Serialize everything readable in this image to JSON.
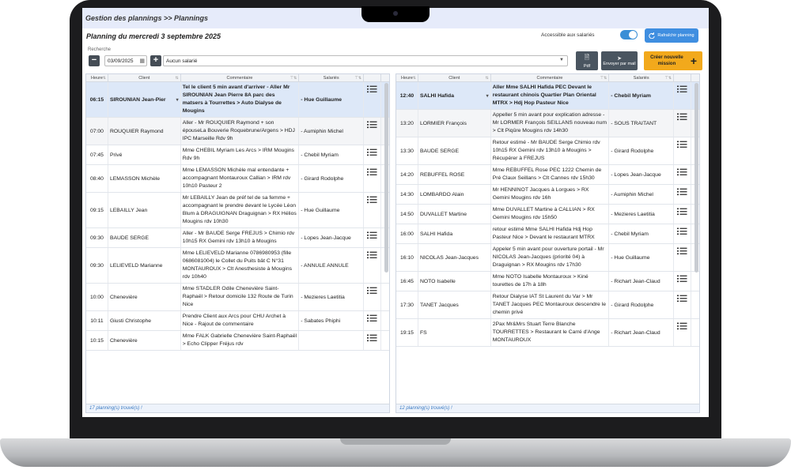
{
  "app": {
    "breadcrumb": "Gestion des plannings >> Plannings",
    "page_title": "Planning du mercredi 3 septembre 2025",
    "accessible_label": "Accessible aux salariés",
    "refresh_label": "Rafraîchir planning",
    "search_label": "Recherche",
    "date_value": "03/09/2025",
    "salarie_select": "Aucun salarié",
    "pdf_label": "Pdf",
    "mail_label": "Envoyer par mail",
    "create_label": "Créer nouvelle mission",
    "accent_color": "#3f8ee0",
    "create_color": "#f2a91c"
  },
  "columns": {
    "heure": "Heure",
    "client": "Client",
    "commentaire": "Commentaire",
    "salaries": "Salariés"
  },
  "left": {
    "footer": "17 planning(s) trouvé(s) !",
    "rows": [
      {
        "heure": "06:15",
        "client": "SIROUNIAN Jean-Pier",
        "commentaire": "Tel le client 5 min avant d'arriver - Aller Mr SIROUNIAN Jean Pierre 8A parc des matsers à Tourrettes > Auto Dialyse de Mougins",
        "salarie": "- Hue Guillaume"
      },
      {
        "heure": "07:00",
        "client": "ROUQUIER Raymond",
        "commentaire": "Aller - Mr ROUQUIER Raymond + son épouseLa Bouverie Roquebrune/Argens > HDJ IPC Marseille Rdv 9h",
        "salarie": "- Aumiphin Michel"
      },
      {
        "heure": "07:45",
        "client": "Privé",
        "commentaire": "Mme CHEBIL Myriam Les Arcs > IRM Mougins Rdv 9h",
        "salarie": "- Chebil Myriam"
      },
      {
        "heure": "08:40",
        "client": "LEMASSON Michèle",
        "commentaire": "Mme LEMASSON Michèle mal entendante + accompagnant Montauroux Callian > IRM rdv 10h10 Pasteur 2",
        "salarie": "- Girard Rodolphe"
      },
      {
        "heure": "09:15",
        "client": "LEBAILLY Jean",
        "commentaire": "Mr LEBAILLY Jean de préf tel de sa femme + accompagnant le prendre devant le Lycée Léon Blum à DRAGUIGNAN Draguignan > RX Hélios Mougins rdv 10h30",
        "salarie": "- Hue Guillaume"
      },
      {
        "heure": "09:30",
        "client": "BAUDE SERGE",
        "commentaire": "Aller - Mr BAUDE Serge FREJUS > Chimio rdv 10h15 RX Gemini rdv 13h10 à Mougins",
        "salarie": "- Lopes Jean-Jacque"
      },
      {
        "heure": "09:30",
        "client": "LELIEVELD Marianne",
        "commentaire": "Mme LELIEVELD Marianne 0786980953 (fille 0686081004) le Collet du Puits bât C N°31 MONTAUROUX > Clt Anesthesiste à Mougins rdv 10h40",
        "salarie": "- ANNULE ANNULE"
      },
      {
        "heure": "10:00",
        "client": "Chenevière",
        "commentaire": "Mme STADLER Odile Chenevière Saint-Raphaël > Retour domicile 132 Route de Turin Nice",
        "salarie": "- Mezieres Laetitia"
      },
      {
        "heure": "10:11",
        "client": "Giusti Christophe",
        "commentaire": "Prendre Client aux Arcs pour CHU Archet à Nice - Rajout de commentaire",
        "salarie": "- Sabates Phiphi"
      },
      {
        "heure": "10:15",
        "client": "Chenevière",
        "commentaire": "Mme FALK Gabrielle Chenevière Saint-Raphaël > Echo Clipper Fréjus rdv",
        "salarie": ""
      }
    ]
  },
  "right": {
    "footer": "12 planning(s) trouvé(s) !",
    "rows": [
      {
        "heure": "12:40",
        "client": "SALHI Hafida",
        "commentaire": "Aller Mme SALHI Hafida PEC Devant le restaurant chinois Quartier Plan Oriental MTRX > Hdj Hop Pasteur Nice",
        "salarie": "- Chebil Myriam"
      },
      {
        "heure": "13:20",
        "client": "LORMIER François",
        "commentaire": "Appeller 5 min avant pour explication adresse - Mr LORMER François SEILLANS nouveau num > Clt Piqûre Mougins rdv 14h30",
        "salarie": "- SOUS TRAITANT"
      },
      {
        "heure": "13:30",
        "client": "BAUDE SERGE",
        "commentaire": "Retour estimé - Mr BAUDE Serge Chimio rdv 10h15 RX Gemini rdv 13h10 à Mougins > Récupérer à FREJUS",
        "salarie": "- Girard Rodolphe"
      },
      {
        "heure": "14:20",
        "client": "REBUFFEL ROSE",
        "commentaire": "Mme REBUFFEL Rose PEC 1222 Chemin de Pré Claux Seillans > Clt Cannes rdv 15h30",
        "salarie": "- Lopes Jean-Jacque"
      },
      {
        "heure": "14:30",
        "client": "LOMBARDO Alain",
        "commentaire": "Mr HENNINOT Jacques à Lorgues > RX Gemini Mougins rdv 16h",
        "salarie": "- Aumiphin Michel"
      },
      {
        "heure": "14:50",
        "client": "DUVALLET Martine",
        "commentaire": "Mme DUVALLET Martine à CALLIAN > RX Gemini Mougins rdv 15h50",
        "salarie": "- Mezieres Laetitia"
      },
      {
        "heure": "16:00",
        "client": "SALHI Hafida",
        "commentaire": "retour estimé Mme SALHI Hafida Hdj Hop Pasteur Nice > Devant le restaurant MTRX",
        "salarie": "- Chebil Myriam"
      },
      {
        "heure": "16:10",
        "client": "NICOLAS Jean-Jacques",
        "commentaire": "Appeler 5 min avant pour ouverture portail - Mr NICOLAS Jean-Jacques (priorité 04) à Draguignan > RX Mougins rdv 17h30",
        "salarie": "- Hue Guillaume"
      },
      {
        "heure": "16:45",
        "client": "NOTO Isabelle",
        "commentaire": "Mme NOTO Isabelle Montauroux > Kiné tourettes de 17h à 18h",
        "salarie": "- Richart Jean-Claud"
      },
      {
        "heure": "17:30",
        "client": "TANET Jacques",
        "commentaire": "Retour Dialyse IAT St Laurent du Var > Mr TANET Jacques PEC Montauroux descendre le chemin privé",
        "salarie": "- Girard Rodolphe"
      },
      {
        "heure": "19:15",
        "client": "FS",
        "commentaire": "2Pax Mr&Mrs Stuart Terre Blanche TOURRETTES > Restaurant le Carré d'Ange MONTAUROUX",
        "salarie": "- Richart Jean-Claud"
      }
    ]
  }
}
